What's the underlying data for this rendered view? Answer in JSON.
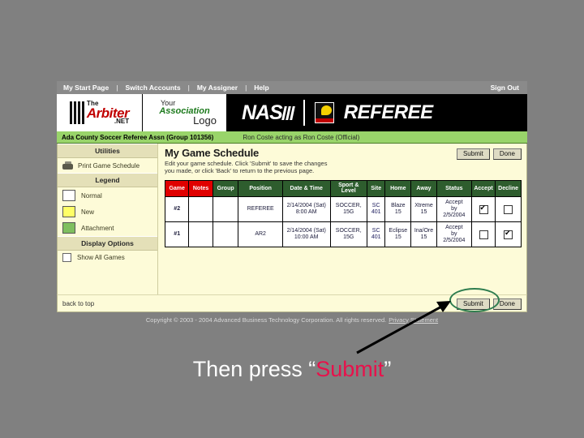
{
  "slide": {
    "caption_prefix": "Then press ",
    "caption_quote_open": "“",
    "caption_accent": "Submit",
    "caption_quote_close": "”",
    "accent_color": "#e8114b",
    "background_color": "#808080",
    "annotation_circle_color": "#2e7d4f"
  },
  "top_nav": {
    "items": [
      "My Start Page",
      "Switch Accounts",
      "My Assigner",
      "Help"
    ],
    "separator": "|",
    "sign_out": "Sign Out"
  },
  "branding": {
    "arbiter": {
      "the": "The",
      "name": "Arbiter",
      "net": ".NET"
    },
    "association": {
      "line1": "Your",
      "line2": "Association",
      "line3": "Logo"
    },
    "naso": "NAS",
    "referee": "REFEREE"
  },
  "context_bar": {
    "organization": "Ada County Soccer Referee Assn (Group 101356)",
    "acting_as": "Ron Coste acting as Ron Coste (Official)"
  },
  "sidebar": {
    "utilities_header": "Utilities",
    "print_label": "Print Game Schedule",
    "legend_header": "Legend",
    "legend": [
      {
        "label": "Normal",
        "color": "#ffffff"
      },
      {
        "label": "New",
        "color": "#ffff66"
      },
      {
        "label": "Attachment",
        "color": "#7fbf5f"
      }
    ],
    "display_options_header": "Display Options",
    "show_all_games_label": "Show All Games",
    "show_all_games_checked": false
  },
  "content": {
    "title": "My Game Schedule",
    "description": "Edit your game schedule. Click 'Submit' to save the changes you made, or click 'Back' to return to the previous page.",
    "submit_label": "Submit",
    "done_label": "Done",
    "back_to_top": "back to top"
  },
  "table": {
    "columns": [
      "Game",
      "Notes",
      "Group",
      "Position",
      "Date & Time",
      "Sport & Level",
      "Site",
      "Home",
      "Away",
      "Status",
      "Accept",
      "Decline"
    ],
    "rows": [
      {
        "game": "#2",
        "notes": "",
        "group": "",
        "position": "REFEREE",
        "date": "2/14/2004 (Sat)",
        "time": "8:00 AM",
        "sport": "SOCCER,",
        "level": "15G",
        "site_line1": "SC",
        "site_line2": "401",
        "home_line1": "Blaze",
        "home_line2": "15",
        "away_line1": "Xtreme",
        "away_line2": "15",
        "status_line1": "Accept",
        "status_line2": "by",
        "status_line3": "2/5/2004",
        "accept_checked": true,
        "decline_checked": false
      },
      {
        "game": "#1",
        "notes": "",
        "group": "",
        "position": "AR2",
        "date": "2/14/2004 (Sat)",
        "time": "10:00 AM",
        "sport": "SOCCER,",
        "level": "15G",
        "site_line1": "SC",
        "site_line2": "401",
        "home_line1": "Eclipse",
        "home_line2": "15",
        "away_line1": "Ina/Ore",
        "away_line2": "15",
        "status_line1": "Accept",
        "status_line2": "by",
        "status_line3": "2/5/2004",
        "accept_checked": false,
        "decline_checked": true
      }
    ]
  },
  "footer": {
    "copyright": "Copyright © 2003 - 2004 Advanced Business Technology Corporation. All rights reserved.",
    "privacy_link": "Privacy Statement"
  }
}
